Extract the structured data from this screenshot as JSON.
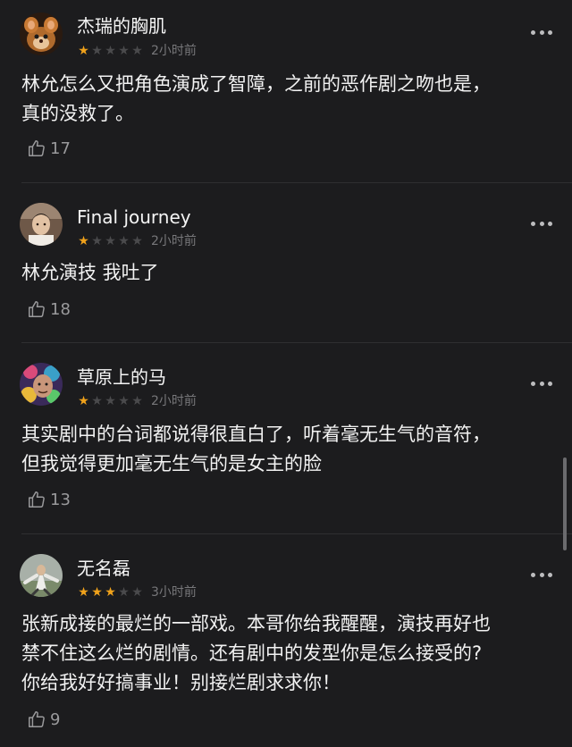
{
  "comments": [
    {
      "username": "杰瑞的胸肌",
      "rating": 1,
      "stars": [
        "★",
        "★",
        "★",
        "★",
        "★"
      ],
      "time": "2小时前",
      "lines": [
        "林允怎么又把角色演成了智障，之前的恶作剧之吻也是，",
        "真的没救了。"
      ],
      "likes": "17",
      "avatar_color": "#b06a2c"
    },
    {
      "username": "Final journey",
      "rating": 1,
      "stars": [
        "★",
        "★",
        "★",
        "★",
        "★"
      ],
      "time": "2小时前",
      "lines": [
        "林允演技 我吐了"
      ],
      "likes": "18",
      "avatar_color": "#8c6a55"
    },
    {
      "username": "草原上的马",
      "rating": 1,
      "stars": [
        "★",
        "★",
        "★",
        "★",
        "★"
      ],
      "time": "2小时前",
      "lines": [
        "其实剧中的台词都说得很直白了，听着毫无生气的音符，",
        "但我觉得更加毫无生气的是女主的脸"
      ],
      "likes": "13",
      "avatar_color": "#4a3a6e"
    },
    {
      "username": "无名磊",
      "rating": 3,
      "stars": [
        "★",
        "★",
        "★",
        "★",
        "★"
      ],
      "time": "3小时前",
      "lines": [
        "张新成接的最烂的一部戏。本哥你给我醒醒，演技再好也",
        "禁不住这么烂的剧情。还有剧中的发型你是怎么接受的?",
        "你给我好好搞事业！别接烂剧求求你！"
      ],
      "likes": "9",
      "avatar_color": "#7f8a82"
    }
  ],
  "colors": {
    "background": "#1c1c1e",
    "star_on": "#f0a21b",
    "star_off": "#4a4a4c"
  }
}
